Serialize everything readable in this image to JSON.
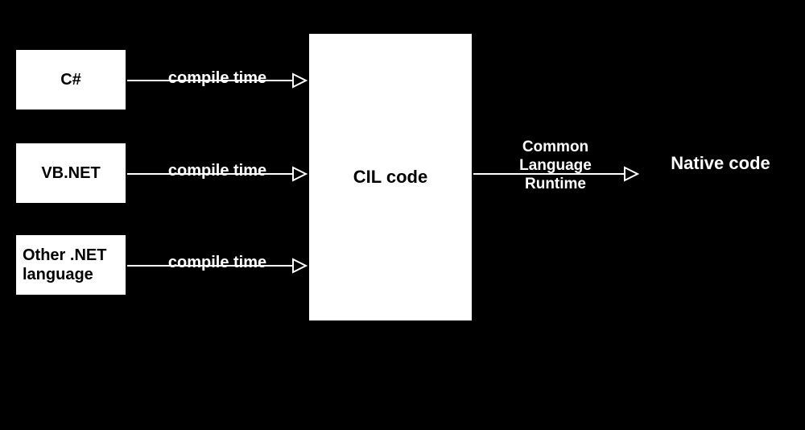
{
  "boxes": {
    "csharp": "C#",
    "vbnet": "VB.NET",
    "other": "Other .NET language",
    "cil": "CIL code"
  },
  "edges": {
    "compiler1": "compile time",
    "compiler2": "compile time",
    "compiler3": "compile time",
    "clr": "Common Language Runtime",
    "native": "Native code"
  }
}
